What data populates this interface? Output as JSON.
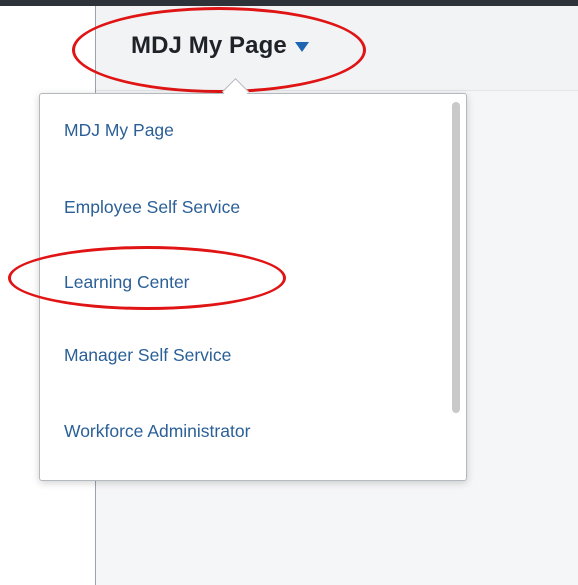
{
  "header": {
    "homepage_title": "MDJ My Page",
    "caret_icon": "chevron-down-icon",
    "accent_color": "#1f66b2"
  },
  "menu": {
    "items": [
      {
        "label": "MDJ My Page"
      },
      {
        "label": "Employee Self Service"
      },
      {
        "label": "Learning Center"
      },
      {
        "label": "Manager Self Service"
      },
      {
        "label": "Workforce Administrator"
      }
    ],
    "link_color": "#2a5f97"
  },
  "annotations": {
    "highlight_color": "#e01414"
  }
}
